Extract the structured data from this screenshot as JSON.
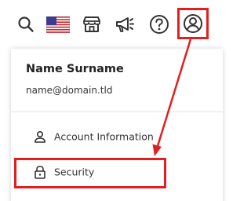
{
  "toolbar": {
    "icons": [
      "search-icon",
      "us-flag-icon",
      "store-icon",
      "megaphone-icon",
      "help-icon",
      "account-icon"
    ]
  },
  "account_menu": {
    "name": "Name Surname",
    "email": "name@domain.tld",
    "items": [
      {
        "label": "Account Information",
        "icon": "user-icon"
      },
      {
        "label": "Security",
        "icon": "lock-icon"
      }
    ]
  },
  "annotation": {
    "color": "#e02020"
  }
}
